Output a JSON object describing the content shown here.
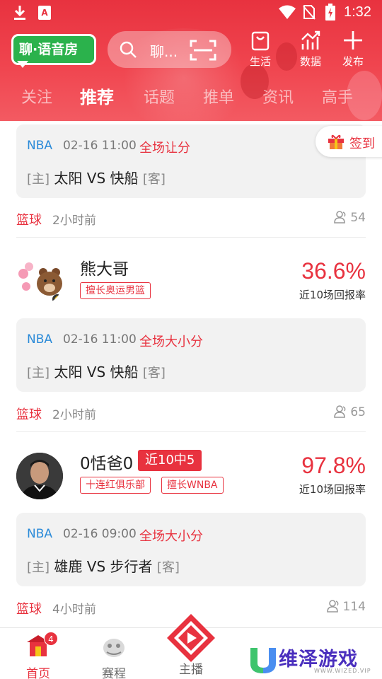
{
  "status_bar": {
    "time": "1:32",
    "app_icon_letter": "A"
  },
  "header": {
    "logo_text": "聊·语音房",
    "search_placeholder": "聊...",
    "buttons": [
      {
        "label": "生活",
        "icon": "bag-icon"
      },
      {
        "label": "数据",
        "icon": "chart-icon"
      },
      {
        "label": "发布",
        "icon": "plus-icon"
      }
    ],
    "tabs": [
      "关注",
      "推荐",
      "话题",
      "推单",
      "资讯",
      "高手"
    ],
    "active_tab": "推荐"
  },
  "signin": {
    "label": "签到"
  },
  "posts": [
    {
      "match": {
        "league": "NBA",
        "time": "02-16 11:00",
        "bet_type": "全场让分",
        "home_tag": "[主]",
        "teams": "太阳 VS 快船",
        "away_tag": "[客]"
      },
      "meta": {
        "category": "篮球",
        "posted": "2小时前",
        "views": "54"
      }
    },
    {
      "author": {
        "name": "熊大哥",
        "tags": [
          "擅长奥运男篮"
        ],
        "rate": "36.6%",
        "rate_label": "近10场回报率"
      },
      "match": {
        "league": "NBA",
        "time": "02-16 11:00",
        "bet_type": "全场大小分",
        "home_tag": "[主]",
        "teams": "太阳 VS 快船",
        "away_tag": "[客]"
      },
      "meta": {
        "category": "篮球",
        "posted": "2小时前",
        "views": "65"
      }
    },
    {
      "author": {
        "name": "0恬爸0",
        "badge": "近10中5",
        "tags": [
          "十连红俱乐部",
          "擅长WNBA"
        ],
        "rate": "97.8%",
        "rate_label": "近10场回报率"
      },
      "match": {
        "league": "NBA",
        "time": "02-16 09:00",
        "bet_type": "全场大小分",
        "home_tag": "[主]",
        "teams": "雄鹿 VS 步行者",
        "away_tag": "[客]"
      },
      "meta": {
        "category": "篮球",
        "posted": "4小时前",
        "views": "114"
      }
    }
  ],
  "bottom_nav": {
    "items": [
      {
        "label": "首页",
        "active": true,
        "badge": "4"
      },
      {
        "label": "赛程",
        "active": false
      },
      {
        "label": "主播",
        "active": false
      }
    ]
  },
  "watermark": {
    "text": "维泽游戏",
    "sub": "WWW.WIZED.VIP"
  },
  "colors": {
    "primary": "#e8323f",
    "league": "#2a8ad8",
    "logo_green": "#2bb24c"
  }
}
